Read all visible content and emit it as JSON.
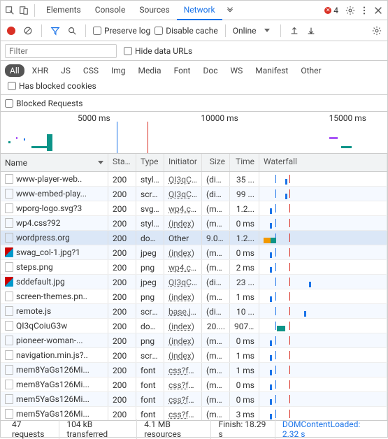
{
  "tabs": {
    "items": [
      "Elements",
      "Console",
      "Sources",
      "Network"
    ],
    "active": 3,
    "errorCount": "4"
  },
  "toolbar": {
    "preserve": "Preserve log",
    "disable": "Disable cache",
    "online": "Online"
  },
  "filter": {
    "placeholder": "Filter",
    "hide": "Hide data URLs"
  },
  "types": {
    "items": [
      "All",
      "XHR",
      "JS",
      "CSS",
      "Img",
      "Media",
      "Font",
      "Doc",
      "WS",
      "Manifest",
      "Other"
    ],
    "active": 0,
    "blockedCookies": "Has blocked cookies"
  },
  "blocked": "Blocked Requests",
  "timelineTicks": [
    "5000 ms",
    "10000 ms",
    "15000 ms"
  ],
  "headers": {
    "name": "Name",
    "status": "Stat...",
    "type": "Type",
    "initiator": "Initiator",
    "size": "Size",
    "time": "Time",
    "waterfall": "Waterfall"
  },
  "rows": [
    {
      "name": "www-player-web..",
      "status": "200",
      "type": "styl...",
      "init": "QI3qCoi...",
      "size": "(dis...",
      "time": "35 ...",
      "wf": [
        {
          "l": 18,
          "w": 1,
          "c": "#1a73e8"
        }
      ]
    },
    {
      "name": "www-embed-play...",
      "status": "200",
      "type": "script",
      "init": "QI3qCoi...",
      "size": "(dis...",
      "time": "99 ...",
      "wf": [
        {
          "l": 18,
          "w": 1,
          "c": "#1a73e8"
        }
      ]
    },
    {
      "name": "wporg-logo.svg?3",
      "status": "200",
      "type": "svg...",
      "init": "wp4.css?...",
      "size": "(me...",
      "time": "1.2...",
      "wf": [
        {
          "l": 5,
          "w": 1,
          "c": "#1a73e8"
        }
      ]
    },
    {
      "name": "wp4.css?92",
      "status": "200",
      "type": "styl...",
      "init": "(index)",
      "size": "(me...",
      "time": "0 ms",
      "wf": [
        {
          "l": 5,
          "w": 1,
          "c": "#1a73e8"
        }
      ]
    },
    {
      "name": "wordpress.org",
      "status": "200",
      "type": "doc...",
      "init": "Other",
      "size": "9.0 ...",
      "time": "1.2...",
      "wf": [
        {
          "l": 0,
          "w": 6,
          "c": "#f29900"
        },
        {
          "l": 6,
          "w": 4,
          "c": "#0d9488"
        }
      ],
      "sel": true,
      "initPlain": true
    },
    {
      "name": "swag_col-1.jpg?1",
      "status": "200",
      "type": "jpeg",
      "init": "(index)",
      "size": "(me...",
      "time": "0 ms",
      "wf": [
        {
          "l": 5,
          "w": 1,
          "c": "#1a73e8"
        }
      ],
      "img": true
    },
    {
      "name": "steps.png",
      "status": "200",
      "type": "png",
      "init": "wp4.css?...",
      "size": "(me...",
      "time": "2 ms",
      "wf": [
        {
          "l": 5,
          "w": 1,
          "c": "#1a73e8"
        }
      ]
    },
    {
      "name": "sddefault.jpg",
      "status": "200",
      "type": "jpeg",
      "init": "QI3qCoi...",
      "size": "(dis...",
      "time": "23 ...",
      "wf": [
        {
          "l": 38,
          "w": 1,
          "c": "#1a73e8"
        }
      ],
      "img": true
    },
    {
      "name": "screen-themes.pn..",
      "status": "200",
      "type": "png",
      "init": "(index)",
      "size": "(me...",
      "time": "1 ms",
      "wf": [
        {
          "l": 5,
          "w": 1,
          "c": "#1a73e8"
        }
      ]
    },
    {
      "name": "remote.js",
      "status": "200",
      "type": "script",
      "init": "base.js:3...",
      "size": "(dis...",
      "time": "10 ...",
      "wf": [
        {
          "l": 34,
          "w": 1,
          "c": "#1a73e8"
        }
      ]
    },
    {
      "name": "QI3qCoiuG3w",
      "status": "200",
      "type": "doc...",
      "init": "(index)",
      "size": "20....",
      "time": "907...",
      "wf": [
        {
          "l": 11,
          "w": 6,
          "c": "#0d9488"
        }
      ]
    },
    {
      "name": "pioneer-woman-...",
      "status": "200",
      "type": "png",
      "init": "(index)",
      "size": "(me...",
      "time": "0 ms",
      "wf": [
        {
          "l": 5,
          "w": 1,
          "c": "#1a73e8"
        }
      ]
    },
    {
      "name": "navigation.min.js?..",
      "status": "200",
      "type": "script",
      "init": "(index)",
      "size": "(me...",
      "time": "1 ms",
      "wf": [
        {
          "l": 5,
          "w": 1,
          "c": "#1a73e8"
        }
      ]
    },
    {
      "name": "mem8YaGs126Mi...",
      "status": "200",
      "type": "font",
      "init": "css?fami...",
      "size": "(me...",
      "time": "1 ms",
      "wf": [
        {
          "l": 5,
          "w": 1,
          "c": "#1a73e8"
        }
      ]
    },
    {
      "name": "mem8YaGs126Mi...",
      "status": "200",
      "type": "font",
      "init": "css?fami...",
      "size": "(me...",
      "time": "0 ms",
      "wf": [
        {
          "l": 5,
          "w": 1,
          "c": "#1a73e8"
        }
      ]
    },
    {
      "name": "mem5YaGs126Mi...",
      "status": "200",
      "type": "font",
      "init": "css?fami...",
      "size": "(me...",
      "time": "0 ms",
      "wf": [
        {
          "l": 5,
          "w": 1,
          "c": "#1a73e8"
        }
      ]
    },
    {
      "name": "mem5YaGs126Mi...",
      "status": "200",
      "type": "font",
      "init": "css?fami...",
      "size": "(me...",
      "time": "3 ms",
      "wf": [
        {
          "l": 5,
          "w": 1,
          "c": "#1a73e8"
        }
      ]
    }
  ],
  "footer": {
    "requests": "47 requests",
    "transferred": "104 kB transferred",
    "resources": "4.1 MB resources",
    "finish": "Finish: 18.29 s",
    "dcl": "DOMContentLoaded: 2.32 s"
  },
  "waterfallLines": [
    {
      "l": 10,
      "c": "#1a73e8"
    },
    {
      "l": 22,
      "c": "#d93025"
    }
  ]
}
